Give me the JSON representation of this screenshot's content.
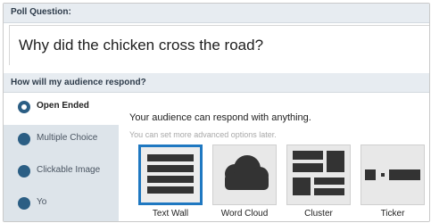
{
  "poll": {
    "header": "Poll Question:",
    "question_value": "Why did the chicken cross the road?"
  },
  "respond": {
    "header": "How will my audience respond?",
    "options": [
      {
        "label": "Open Ended",
        "selected": true
      },
      {
        "label": "Multiple Choice",
        "selected": false
      },
      {
        "label": "Clickable Image",
        "selected": false
      },
      {
        "label": "Yo",
        "selected": false
      }
    ],
    "description": "Your audience can respond with anything.",
    "hint": "You can set more advanced options later.",
    "layouts": [
      {
        "label": "Text Wall",
        "icon": "text-wall-icon",
        "selected": true
      },
      {
        "label": "Word Cloud",
        "icon": "word-cloud-icon",
        "selected": false
      },
      {
        "label": "Cluster",
        "icon": "cluster-icon",
        "selected": false
      },
      {
        "label": "Ticker",
        "icon": "ticker-icon",
        "selected": false
      }
    ]
  },
  "colors": {
    "accent": "#1f78c1",
    "icon": "#333333",
    "radio": "#2b5e84",
    "header_bg": "#e7ecf1",
    "sidebar_bg": "#dde4ea"
  }
}
